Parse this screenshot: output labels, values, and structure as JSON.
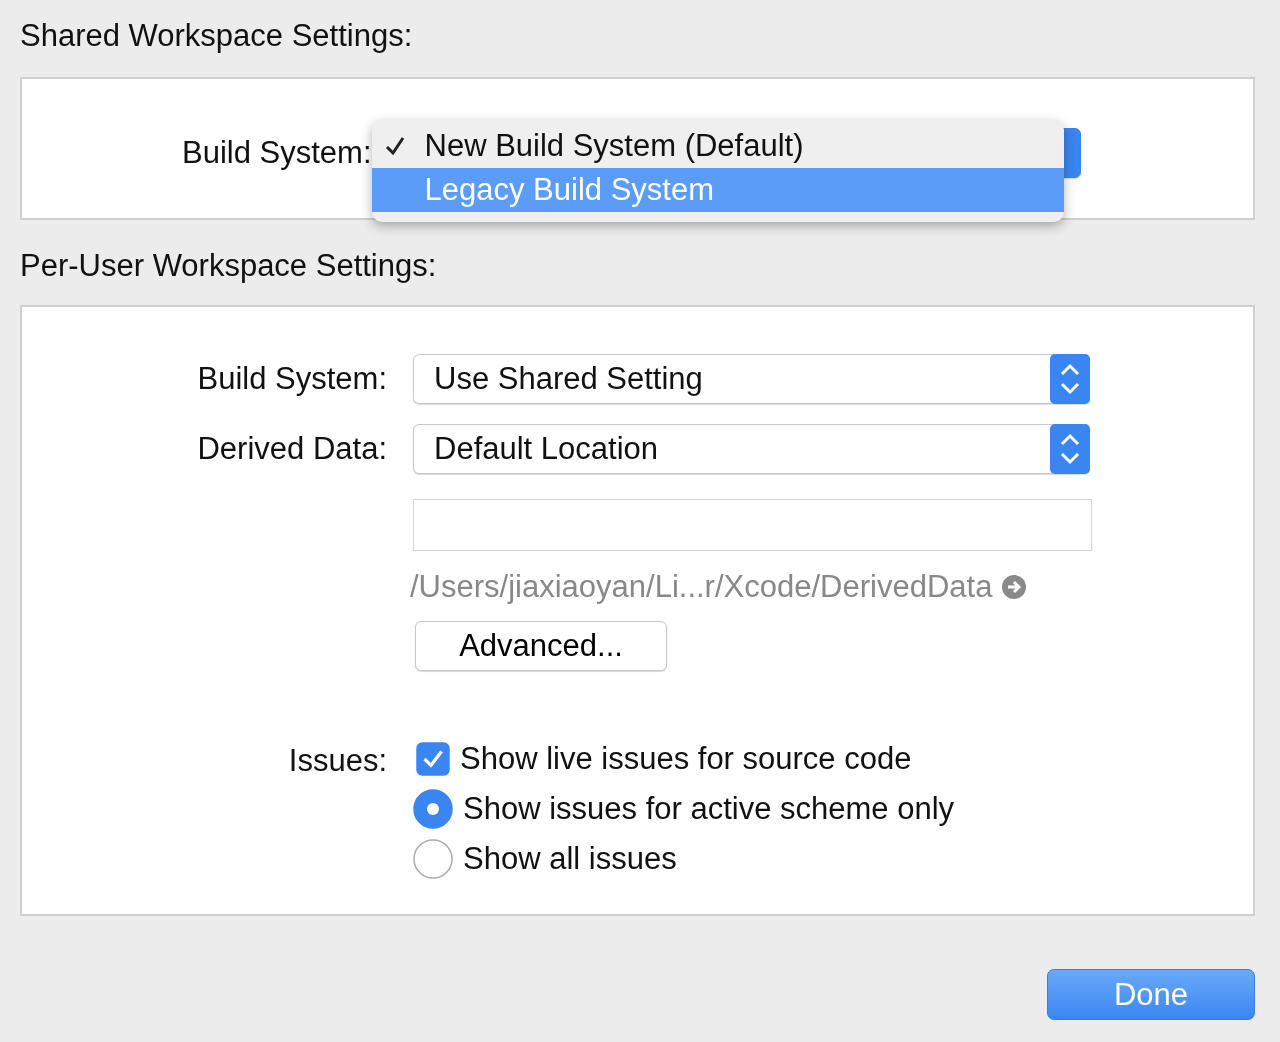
{
  "shared": {
    "title": "Shared Workspace Settings:",
    "build_system": {
      "label": "Build System:",
      "menu": [
        {
          "label": "New Build System (Default)",
          "checked": true,
          "selected": false
        },
        {
          "label": "Legacy Build System",
          "checked": false,
          "selected": true
        }
      ]
    }
  },
  "per_user": {
    "title": "Per-User Workspace Settings:",
    "rows": [
      {
        "label": "Build System:",
        "value": "Use Shared Setting"
      },
      {
        "label": "Derived Data:",
        "value": "Default Location"
      }
    ],
    "path": "/Users/jiaxiaoyan/Li...r/Xcode/DerivedData",
    "advanced": "Advanced...",
    "issues": {
      "label": "Issues:",
      "options": [
        {
          "kind": "checkbox",
          "label": "Show live issues for source code",
          "checked": true
        },
        {
          "kind": "radio",
          "label": "Show issues for active scheme only",
          "selected": true
        },
        {
          "kind": "radio",
          "label": "Show all issues",
          "selected": false
        }
      ]
    }
  },
  "done": "Done"
}
